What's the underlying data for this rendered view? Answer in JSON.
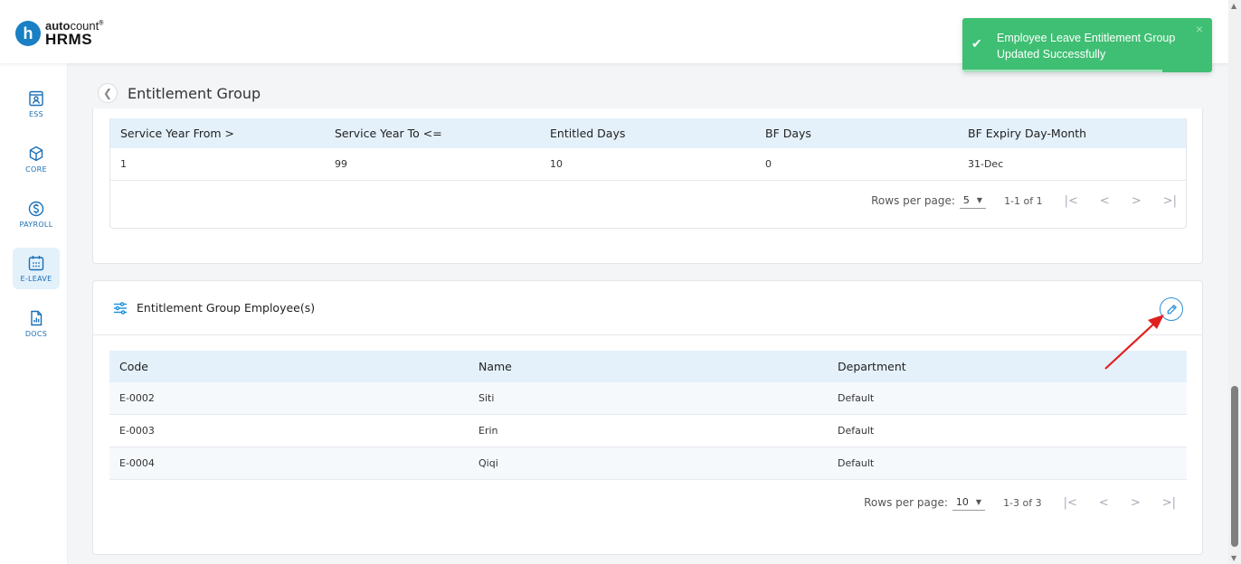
{
  "brand": {
    "top_bold": "auto",
    "top_light": "count",
    "top_mark": "®",
    "bottom": "HRMS",
    "circle_letter": "h"
  },
  "sidebar": {
    "items": [
      {
        "label": "ESS",
        "icon": "ess-icon"
      },
      {
        "label": "CORE",
        "icon": "core-icon"
      },
      {
        "label": "PAYROLL",
        "icon": "payroll-icon"
      },
      {
        "label": "E-LEAVE",
        "icon": "calendar-icon",
        "active": true
      },
      {
        "label": "DOCS",
        "icon": "docs-icon"
      }
    ]
  },
  "page": {
    "title": "Entitlement Group"
  },
  "entitlement_table": {
    "columns": [
      "Service Year From >",
      "Service Year To <=",
      "Entitled Days",
      "BF Days",
      "BF Expiry Day-Month"
    ],
    "rows": [
      [
        "1",
        "99",
        "10",
        "0",
        "31-Dec"
      ]
    ],
    "pager": {
      "rows_per_page_label": "Rows per page:",
      "rows_per_page": "5",
      "range": "1-1 of 1"
    }
  },
  "employees_section": {
    "title": "Entitlement Group Employee(s)",
    "columns": [
      "Code",
      "Name",
      "Department"
    ],
    "rows": [
      [
        "E-0002",
        "Siti",
        "Default"
      ],
      [
        "E-0003",
        "Erin",
        "Default"
      ],
      [
        "E-0004",
        "Qiqi",
        "Default"
      ]
    ],
    "pager": {
      "rows_per_page_label": "Rows per page:",
      "rows_per_page": "10",
      "range": "1-3 of 3"
    }
  },
  "toast": {
    "message": "Employee Leave Entitlement Group Updated Successfully",
    "close": "×",
    "progress": 0.8
  },
  "colors": {
    "accent": "#1a7fc4",
    "toast_green": "#3fbf73",
    "annotation_red": "#e02020",
    "header_row": "#e4f1fb"
  }
}
